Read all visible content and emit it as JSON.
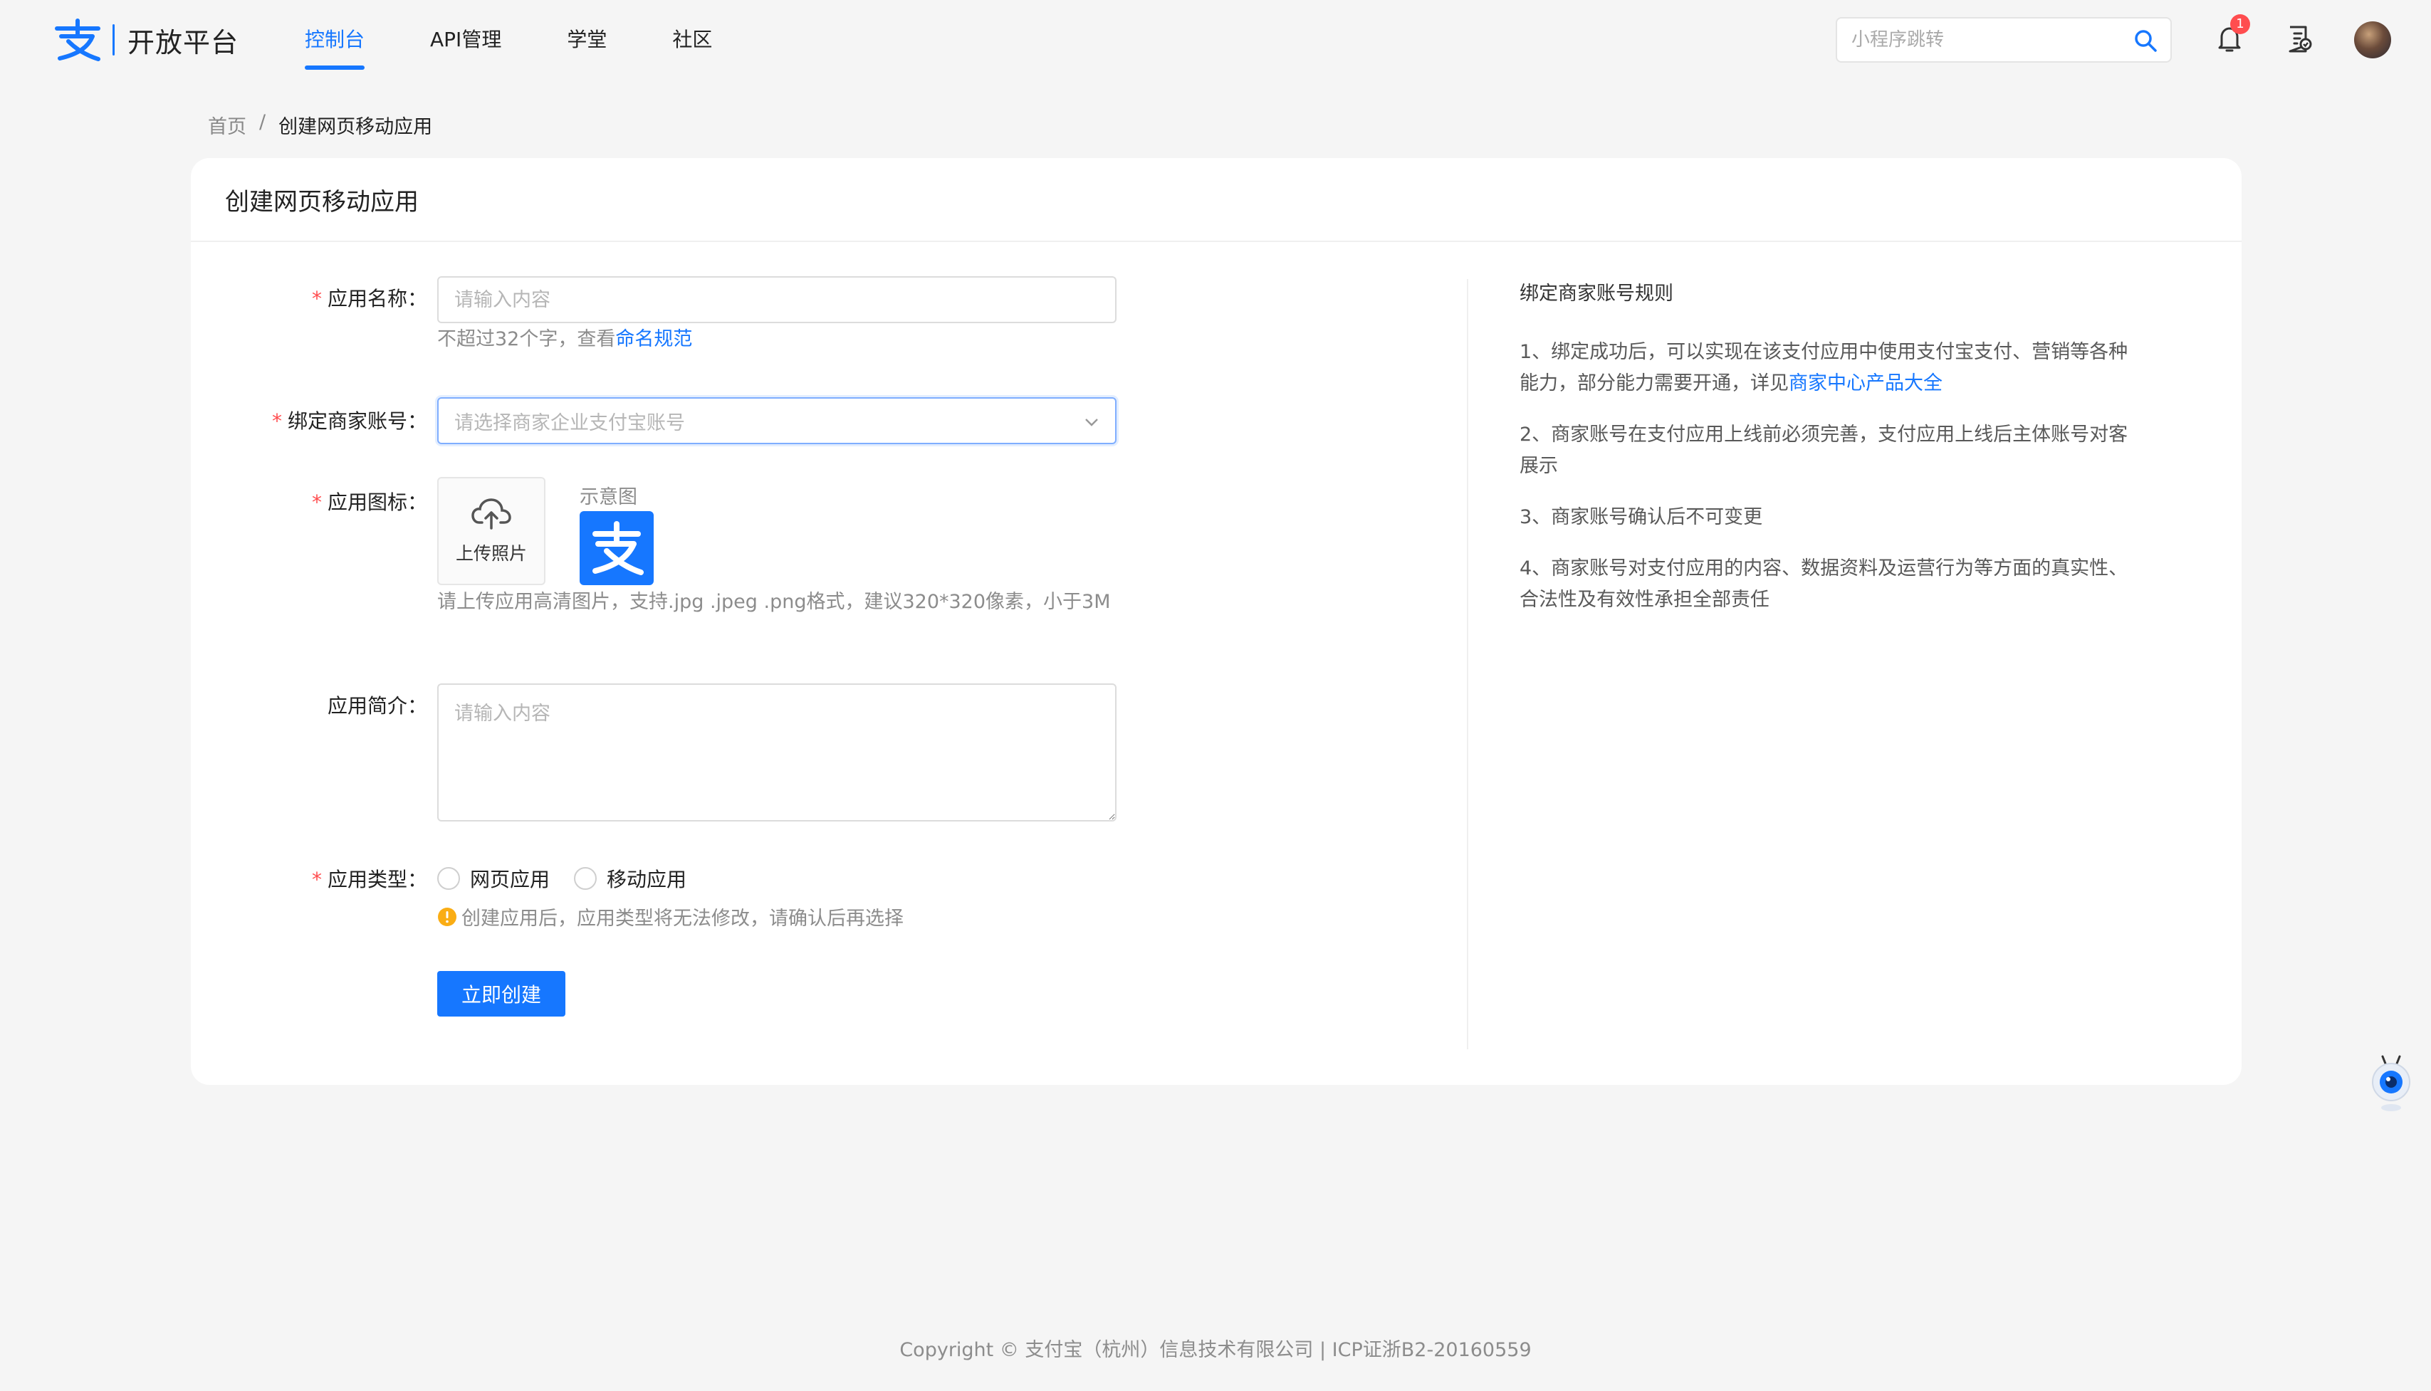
{
  "brand": {
    "name": "开放平台"
  },
  "nav": {
    "items": [
      "控制台",
      "API管理",
      "学堂",
      "社区"
    ],
    "active": "控制台"
  },
  "toolbar": {
    "search_placeholder": "小程序跳转",
    "notification_count": "1"
  },
  "breadcrumb": {
    "home": "首页",
    "separator": "/",
    "current": "创建网页移动应用"
  },
  "card": {
    "title": "创建网页移动应用"
  },
  "form": {
    "app_name": {
      "label": "应用名称",
      "required_mark": "*",
      "placeholder": "请输入内容",
      "help_prefix": "不超过32个字，查看",
      "help_link": "命名规范"
    },
    "merchant": {
      "label": "绑定商家账号",
      "required_mark": "*",
      "placeholder": "请选择商家企业支付宝账号"
    },
    "icon": {
      "label": "应用图标",
      "required_mark": "*",
      "upload_text": "上传照片",
      "sample_label": "示意图",
      "help": "请上传应用高清图片，支持.jpg .jpeg .png格式，建议320*320像素，小于3M"
    },
    "intro": {
      "label": "应用简介",
      "placeholder": "请输入内容"
    },
    "type": {
      "label": "应用类型",
      "required_mark": "*",
      "options": [
        "网页应用",
        "移动应用"
      ],
      "warning": "创建应用后，应用类型将无法修改，请确认后再选择"
    },
    "submit_label": "立即创建",
    "label_suffix": "："
  },
  "rules": {
    "title": "绑定商家账号规则",
    "items": [
      {
        "text": "1、绑定成功后，可以实现在该支付应用中使用支付宝支付、营销等各种能力，部分能力需要开通，详见",
        "link": "商家中心产品大全"
      },
      {
        "text": "2、商家账号在支付应用上线前必须完善，支付应用上线后主体账号对客展示",
        "link": ""
      },
      {
        "text": "3、商家账号确认后不可变更",
        "link": ""
      },
      {
        "text": "4、商家账号对支付应用的内容、数据资料及运营行为等方面的真实性、合法性及有效性承担全部责任",
        "link": ""
      }
    ]
  },
  "footer": {
    "text": "Copyright © 支付宝（杭州）信息技术有限公司  |  ICP证浙B2-20160559"
  },
  "colors": {
    "accent": "#1677ff",
    "required": "#ff4d4f",
    "warning": "#faad14",
    "background": "#f5f5f5"
  }
}
